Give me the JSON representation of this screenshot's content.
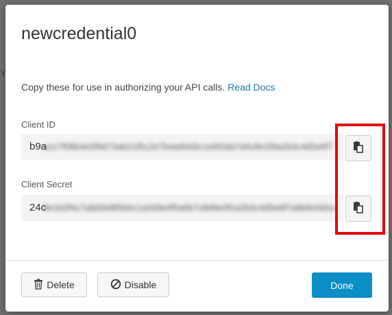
{
  "backdrop": {
    "text": "Y"
  },
  "modal": {
    "title": "newcredential0",
    "intro_text": "Copy these for use in authorizing your API calls.",
    "read_docs_link": "Read Docs",
    "client_id": {
      "label": "Client ID",
      "prefix": "b9a",
      "masked_value": "a1c7f08b4e5f9d73ab21f5c2e7b4a90d3c1e6f2ab7d4c8e1f9a2b3c4d5e6f7",
      "copy_icon": "clipboard-icon"
    },
    "client_secret": {
      "label": "Client Secret",
      "prefix": "24c",
      "masked_value": "9e1b2f4c7a6d3e8f5b0c1a2d3e4f5a6b7c8d9e0f1a2b3c4d5e6f7a8b9c0d1e",
      "copy_icon": "clipboard-icon"
    },
    "buttons": {
      "delete": "Delete",
      "disable": "Disable",
      "done": "Done"
    }
  },
  "colors": {
    "accent": "#0b8ec5",
    "link": "#1f75a8",
    "highlight": "#e3000f"
  }
}
